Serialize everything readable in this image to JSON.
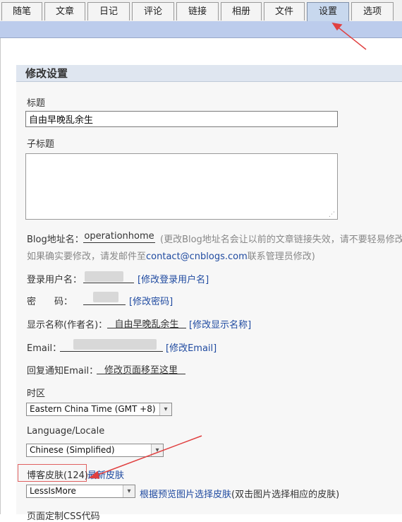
{
  "tabs": [
    "随笔",
    "文章",
    "日记",
    "评论",
    "链接",
    "相册",
    "文件",
    "设置",
    "选项"
  ],
  "section_title": "修改设置",
  "title_label": "标题",
  "title_value": "自由早晚乱余生",
  "subtitle_label": "子标题",
  "blog_url": {
    "label": "Blog地址名：",
    "value": "operationhome",
    "note_line1": "(更改Blog地址名会让以前的文章链接失效，请不要轻易修改",
    "note_line2a": "如果确实要修改，请发邮件至",
    "note_email": "contact@cnblogs.com",
    "note_line2b": "联系管理员修改)"
  },
  "login_user": {
    "label": "登录用户名：",
    "link": "[修改登录用户名]"
  },
  "password": {
    "label": "密　　码：",
    "link": "[修改密码]"
  },
  "display_name": {
    "label": "显示名称(作者名)：",
    "value": "自由早晚乱余生",
    "link": "[修改显示名称]"
  },
  "email": {
    "label": "Email：",
    "link": "[修改Email]"
  },
  "reply_email": {
    "label": "回复通知Email：",
    "value": "修改页面移至这里"
  },
  "timezone": {
    "label": "时区",
    "value": "Eastern China Time (GMT +8)"
  },
  "language": {
    "label": "Language/Locale",
    "value": "Chinese (Simplified)"
  },
  "skin": {
    "label": "博客皮肤(124)",
    "newest_link": "最新皮肤",
    "value": "LessIsMore",
    "preview_link": "根据预览图片选择皮肤",
    "preview_note": "(双击图片选择相应的皮肤)"
  },
  "cut_off_label": "页面定制CSS代码",
  "colors": {
    "annotation": "#e04040",
    "link": "#1f4aa0",
    "active_tab": "#c8d8ee"
  },
  "icons": {
    "dropdown": "chevron-down-icon",
    "resize": "resize-grip-icon"
  }
}
